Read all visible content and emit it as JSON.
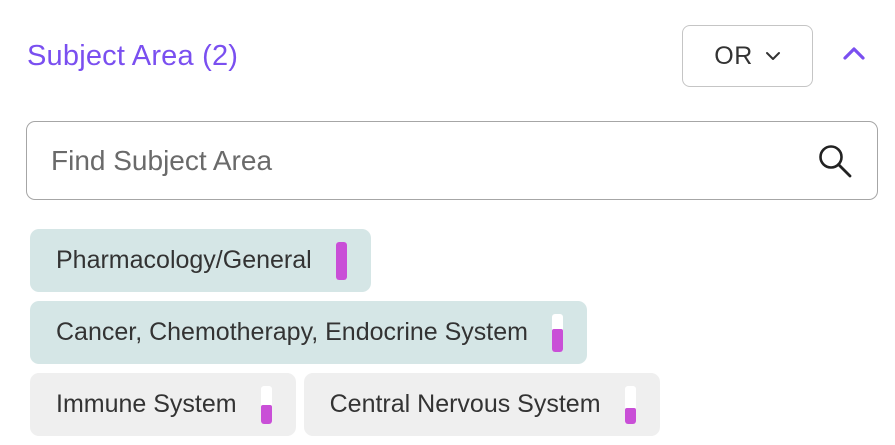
{
  "filter": {
    "title": "Subject Area (2)",
    "operator": {
      "selected": "OR",
      "icon": "chevron-down-icon"
    },
    "collapse_icon": "chevron-up-icon",
    "search": {
      "placeholder": "Find Subject Area",
      "value": "",
      "icon": "search-icon"
    },
    "chips": [
      {
        "label": "Pharmacology/General",
        "selected": true,
        "relative_count": 1.0
      },
      {
        "label": "Cancer, Chemotherapy, Endocrine System",
        "selected": true,
        "relative_count": 0.6
      },
      {
        "label": "Immune System",
        "selected": false,
        "relative_count": 0.5
      },
      {
        "label": "Central Nervous System",
        "selected": false,
        "relative_count": 0.4
      }
    ]
  },
  "colors": {
    "accent": "#7a4ff0",
    "selected_chip": "#d5e6e6",
    "unselected_chip": "#efefef",
    "meter_fill": "#c94fd7"
  }
}
